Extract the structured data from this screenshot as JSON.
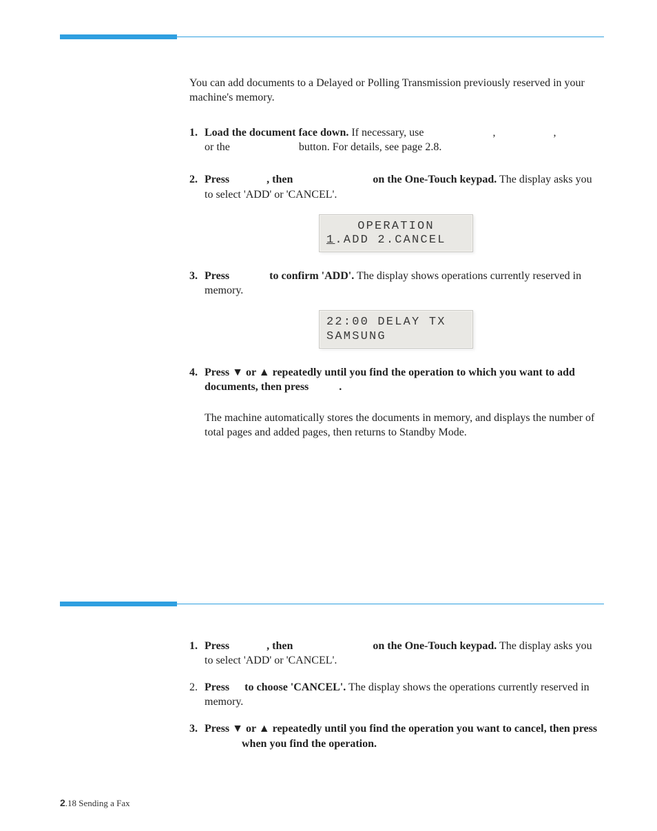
{
  "intro": "You can add documents to a Delayed or Polling Transmission previously reserved in your machine's memory.",
  "s1": {
    "num": "1.",
    "bold": "Load the document face down.",
    "rest1": " If necessary, use ",
    "comma1": ", ",
    "comma2": ",",
    "line2a": "or the ",
    "line2b": " button. For details, see page 2.8."
  },
  "s2": {
    "num": "2.",
    "a": "Press ",
    "b": ", then ",
    "c": " on the One-Touch keypad.",
    "d": " The display asks you to select 'ADD' or 'CANCEL'."
  },
  "lcd1": {
    "l1": "OPERATION",
    "l2a": "1",
    "l2b": ".ADD  2.CANCEL"
  },
  "s3": {
    "num": "3.",
    "a": "Press ",
    "b": " to confirm 'ADD'.",
    "c": " The display shows operations currently reserved in memory."
  },
  "lcd2": {
    "l1": "22:00 DELAY TX",
    "l2": "SAMSUNG"
  },
  "s4": {
    "num": "4.",
    "a": "Press ",
    "down": "▼",
    "or": " or ",
    "up": "▲",
    "b": " repeatedly until you find the operation to which you want to add documents, then press ",
    "dot": "."
  },
  "s4p": "The machine automatically stores the documents in memory, and displays the number of total pages and added pages, then returns to Standby Mode.",
  "c1": {
    "num": "1.",
    "a": "Press ",
    "b": ", then ",
    "c": " on the One-Touch keypad.",
    "d": " The display asks you to select 'ADD' or 'CANCEL'."
  },
  "c2": {
    "num": "2.",
    "a": "Press ",
    "b": " to choose 'CANCEL'.",
    "c": " The display shows the operations currently reserved in memory."
  },
  "c3": {
    "num": "3.",
    "a": "Press ",
    "down": "▼",
    "or": " or ",
    "up": "▲",
    "b": " repeatedly until you find the operation you want to cancel, then press ",
    "c": " when you find the operation."
  },
  "footer": {
    "pg": "2",
    "rest": ".18   Sending a Fax"
  }
}
